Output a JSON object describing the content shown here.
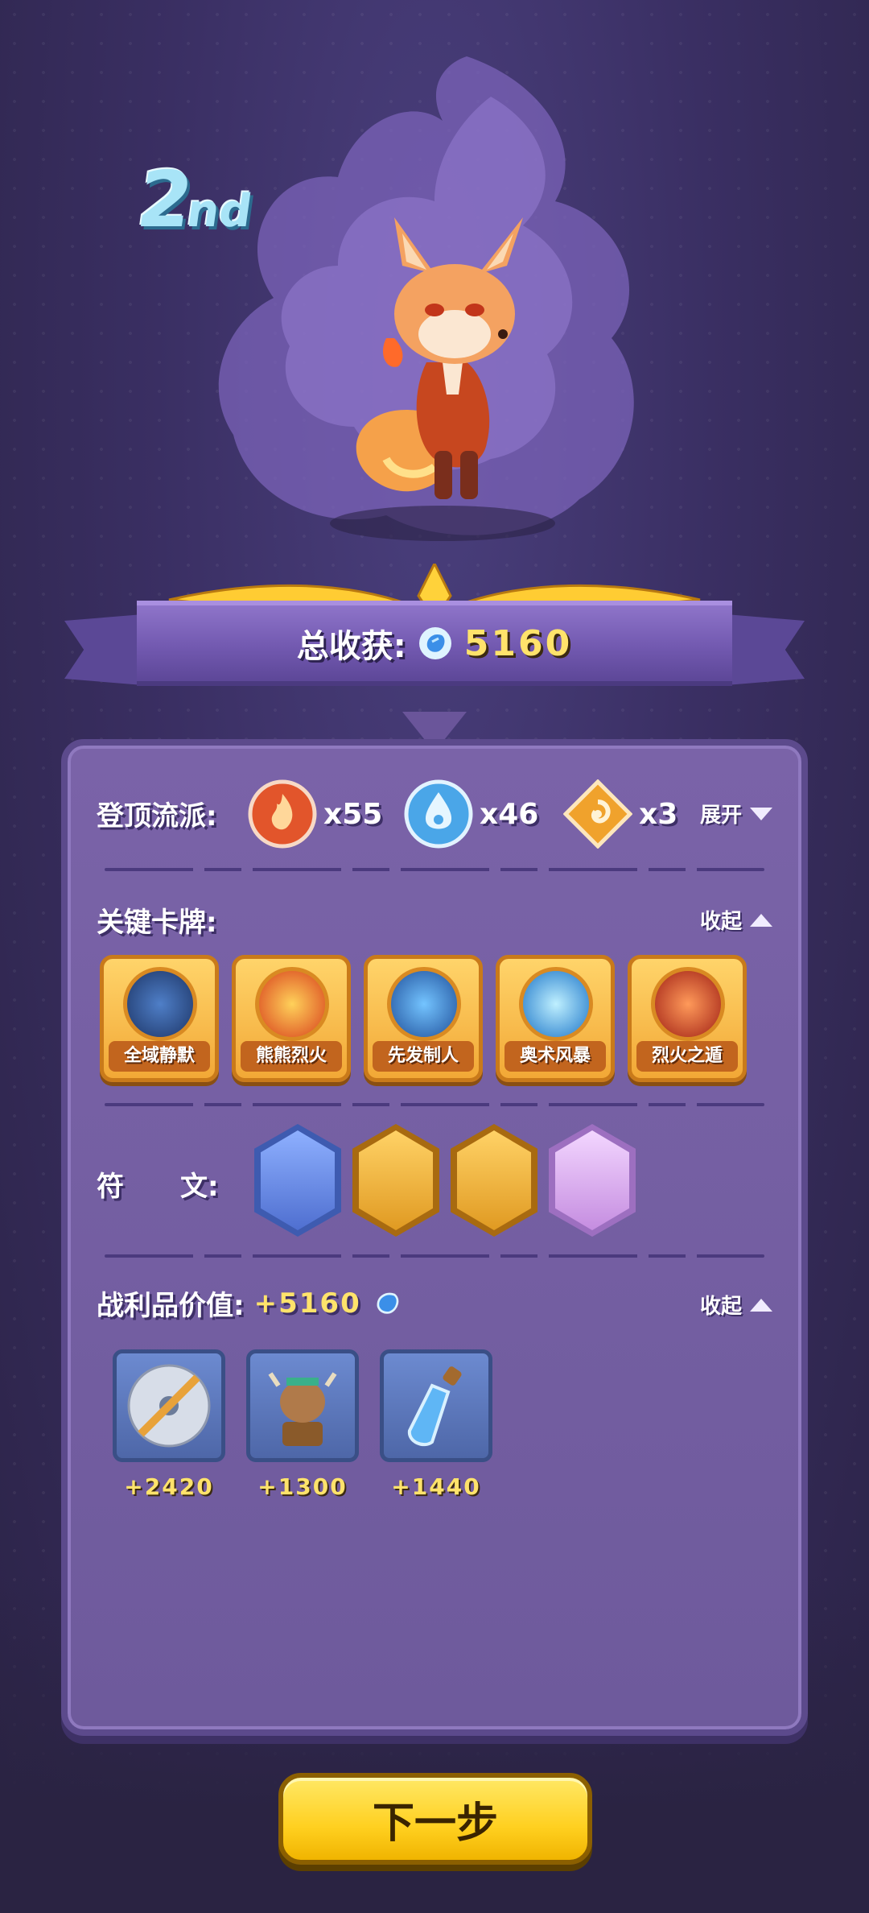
{
  "rank": {
    "number": "2",
    "suffix": "nd"
  },
  "harvest": {
    "label": "总收获:",
    "total": "5160"
  },
  "schools": {
    "label": "登顶流派:",
    "toggle_label": "展开",
    "items": [
      {
        "icon": "fire-school-icon",
        "count": "x55",
        "color": "#e2552b"
      },
      {
        "icon": "water-school-icon",
        "count": "x46",
        "color": "#4aa6e8"
      },
      {
        "icon": "swirl-school-icon",
        "count": "x3",
        "color": "#f0a22c"
      }
    ]
  },
  "key_cards": {
    "label": "关键卡牌:",
    "toggle_label": "收起",
    "items": [
      {
        "name": "全域静默",
        "icon": "silence-card-icon",
        "color": "#2b4f8f"
      },
      {
        "name": "熊熊烈火",
        "icon": "blaze-card-icon",
        "color": "#e2552b"
      },
      {
        "name": "先发制人",
        "icon": "preempt-card-icon",
        "color": "#2f7fd6"
      },
      {
        "name": "奥术风暴",
        "icon": "arcane-storm-card-icon",
        "color": "#2a9be6"
      },
      {
        "name": "烈火之遁",
        "icon": "fire-escape-card-icon",
        "color": "#c9381e"
      }
    ]
  },
  "runes": {
    "label_left": "符",
    "label_right": "文:",
    "items": [
      {
        "icon": "atom-book-rune-icon",
        "color": "#5d7fd8"
      },
      {
        "icon": "atom-book-gold-rune-icon",
        "color": "#e3a128"
      },
      {
        "icon": "motorbike-rune-icon",
        "color": "#e3a128"
      },
      {
        "icon": "gear-portrait-rune-icon",
        "color": "#d89be6"
      }
    ]
  },
  "loot": {
    "label": "战利品价值:",
    "total": "+5160",
    "toggle_label": "收起",
    "items": [
      {
        "icon": "cd-disc-icon",
        "value": "+2420"
      },
      {
        "icon": "bull-statue-icon",
        "value": "+1300"
      },
      {
        "icon": "potion-bottle-icon",
        "value": "+1440"
      }
    ]
  },
  "next_button": {
    "label": "下一步"
  }
}
